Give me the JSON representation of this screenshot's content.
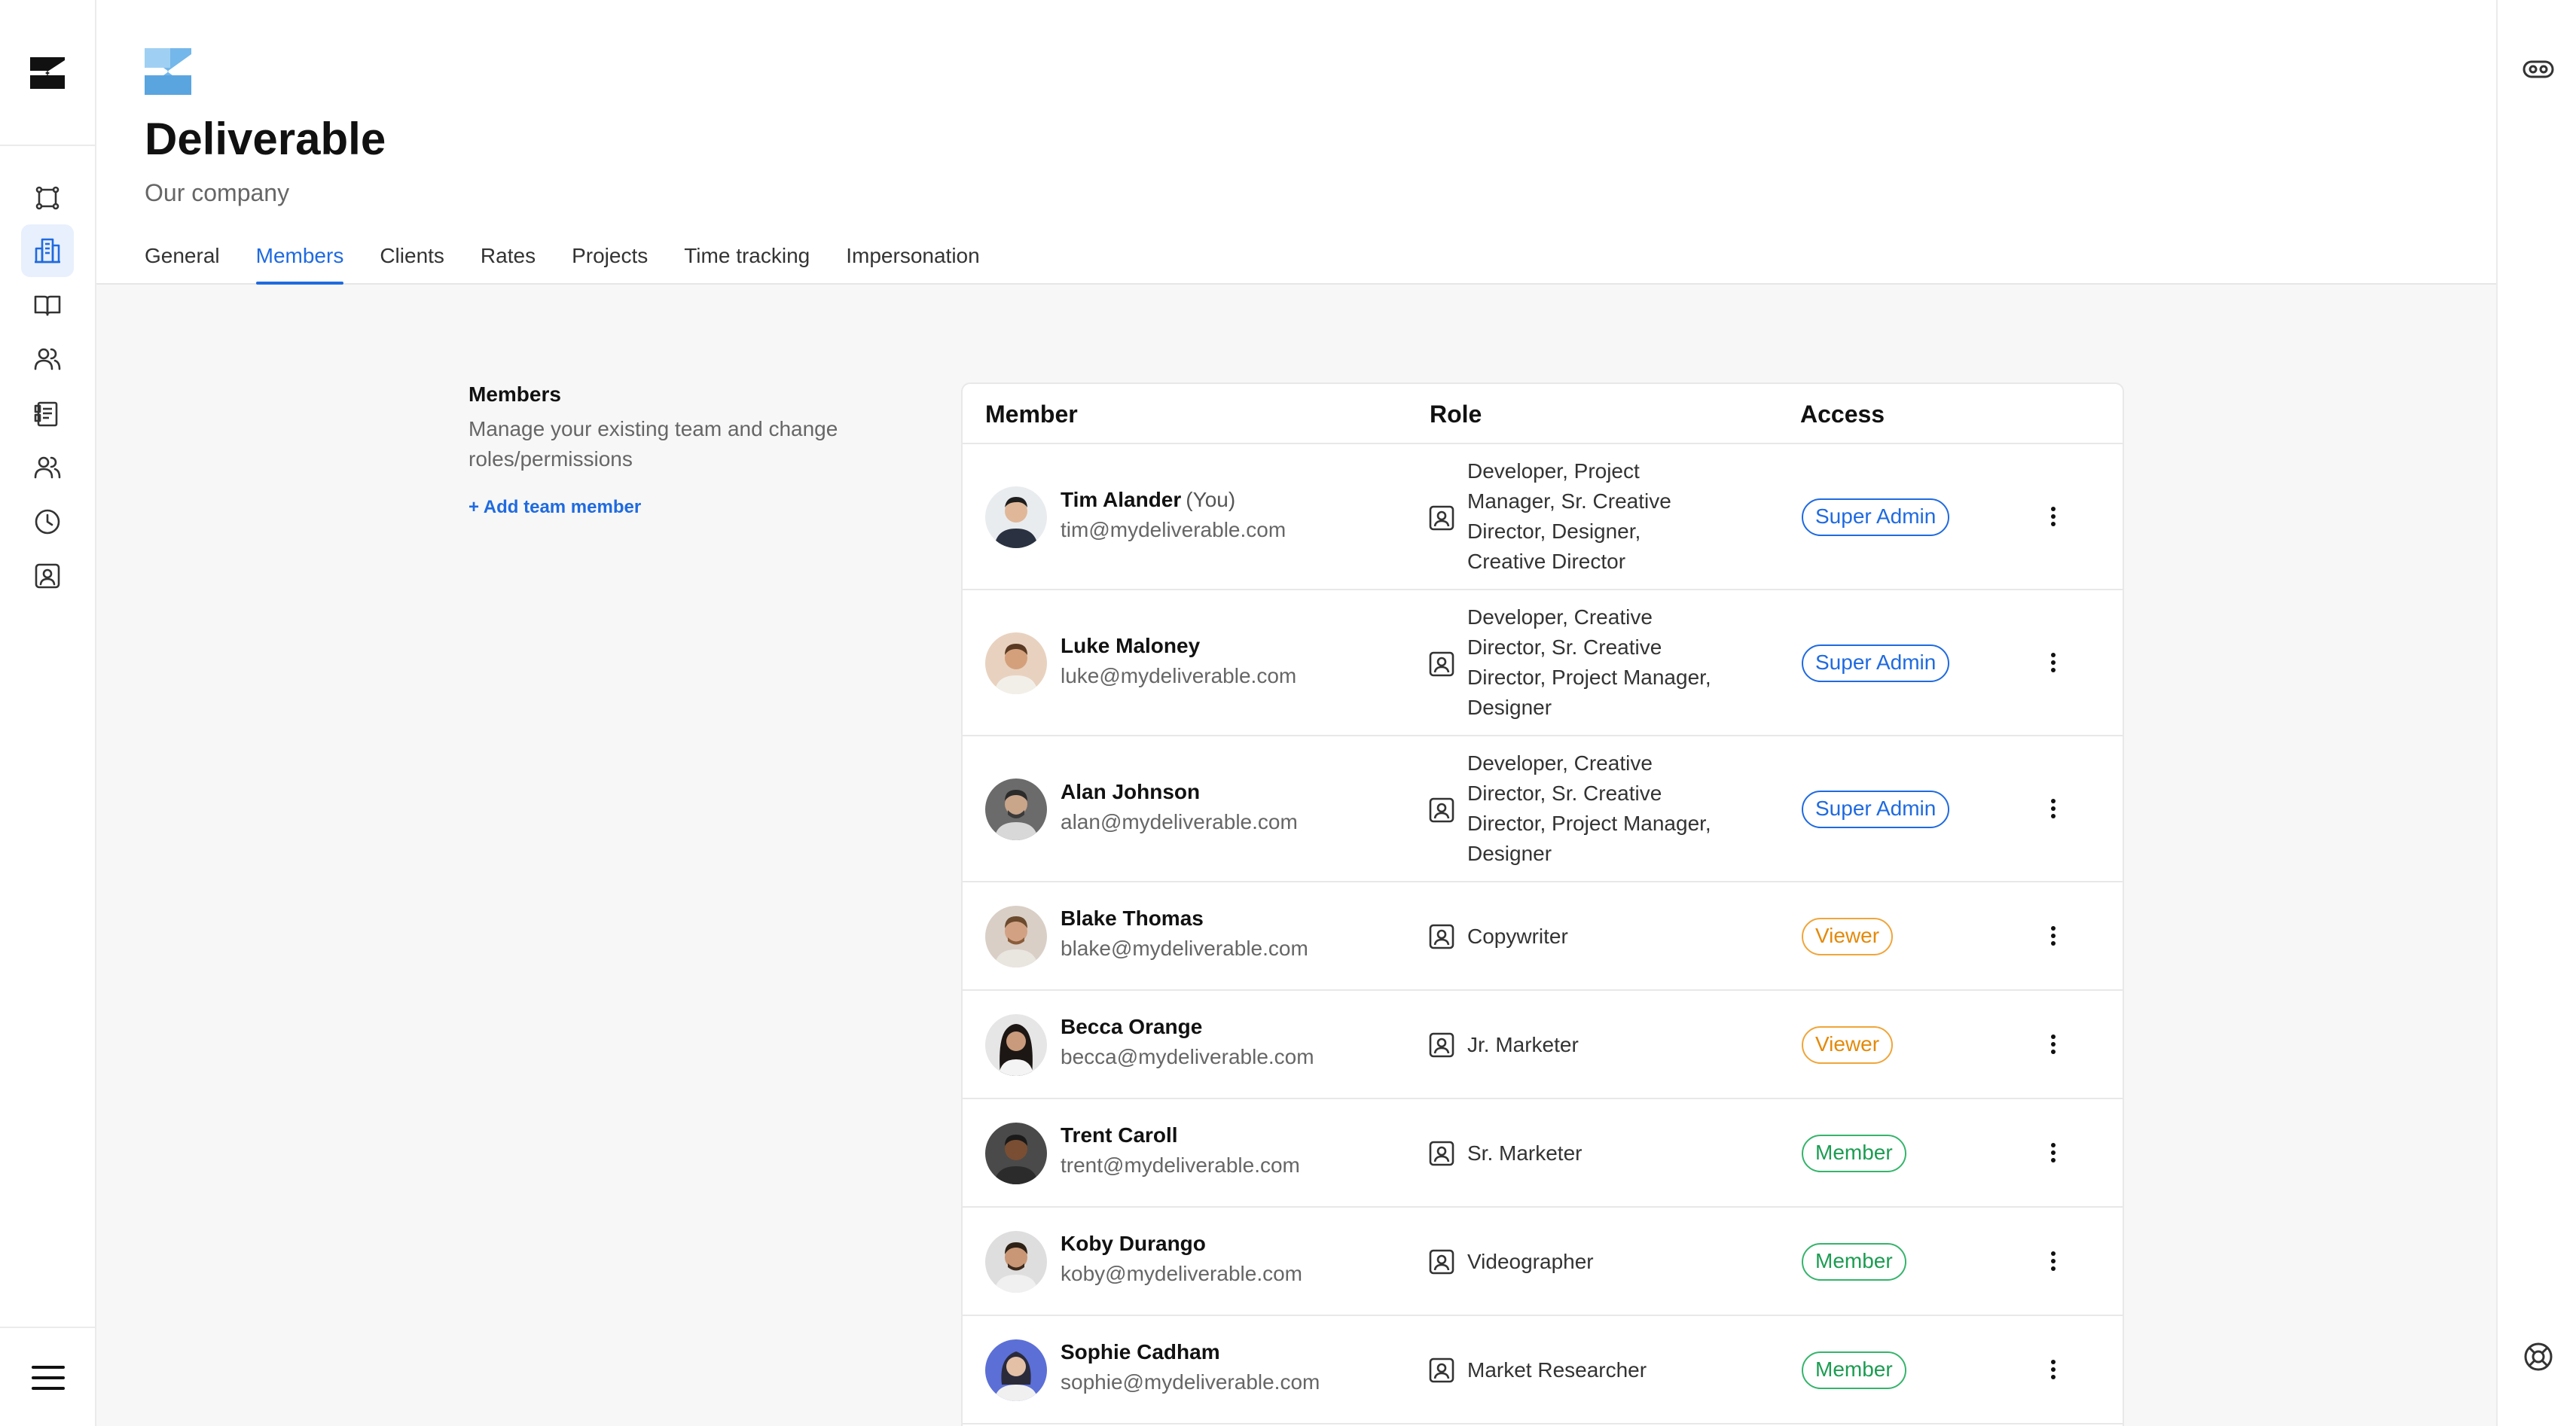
{
  "company": {
    "name": "Deliverable",
    "subtitle": "Our company"
  },
  "tabs": [
    {
      "label": "General"
    },
    {
      "label": "Members",
      "active": true
    },
    {
      "label": "Clients"
    },
    {
      "label": "Rates"
    },
    {
      "label": "Projects"
    },
    {
      "label": "Time tracking"
    },
    {
      "label": "Impersonation"
    }
  ],
  "sidebar": {
    "items": [
      {
        "icon": "frame-icon"
      },
      {
        "icon": "building-icon",
        "active": true
      },
      {
        "icon": "book-icon"
      },
      {
        "icon": "team-icon"
      },
      {
        "icon": "clipboard-icon"
      },
      {
        "icon": "users-icon"
      },
      {
        "icon": "clock-icon"
      },
      {
        "icon": "contact-card-icon"
      }
    ],
    "menu_icon": "hamburger-menu-icon"
  },
  "right_rail": {
    "top_icon": "glasses-icon",
    "bottom_icon": "lifebuoy-icon"
  },
  "intro": {
    "title": "Members",
    "description": "Manage your existing team and change roles/permissions",
    "add_link": "+ Add team member"
  },
  "table": {
    "headers": {
      "member": "Member",
      "role": "Role",
      "access": "Access"
    },
    "rows": [
      {
        "name": "Tim Alander",
        "you": "(You)",
        "email": "tim@mydeliverable.com",
        "role": "Developer, Project Manager, Sr. Creative Director, Designer, Creative Director",
        "access": "Super Admin"
      },
      {
        "name": "Luke Maloney",
        "email": "luke@mydeliverable.com",
        "role": "Developer, Creative Director, Sr. Creative Director, Project Manager, Designer",
        "access": "Super Admin"
      },
      {
        "name": "Alan Johnson",
        "email": "alan@mydeliverable.com",
        "role": "Developer, Creative Director, Sr. Creative Director, Project Manager, Designer",
        "access": "Super Admin"
      },
      {
        "name": "Blake Thomas",
        "email": "blake@mydeliverable.com",
        "role": "Copywriter",
        "access": "Viewer"
      },
      {
        "name": "Becca Orange",
        "email": "becca@mydeliverable.com",
        "role": "Jr. Marketer",
        "access": "Viewer"
      },
      {
        "name": "Trent Caroll",
        "email": "trent@mydeliverable.com",
        "role": "Sr. Marketer",
        "access": "Member"
      },
      {
        "name": "Koby Durango",
        "email": "koby@mydeliverable.com",
        "role": "Videographer",
        "access": "Member"
      },
      {
        "name": "Sophie Cadham",
        "email": "sophie@mydeliverable.com",
        "role": "Market Researcher",
        "access": "Member"
      }
    ]
  },
  "colors": {
    "accent": "#1f6ae0",
    "viewer": "#e38a0a",
    "member": "#1c9c52"
  }
}
